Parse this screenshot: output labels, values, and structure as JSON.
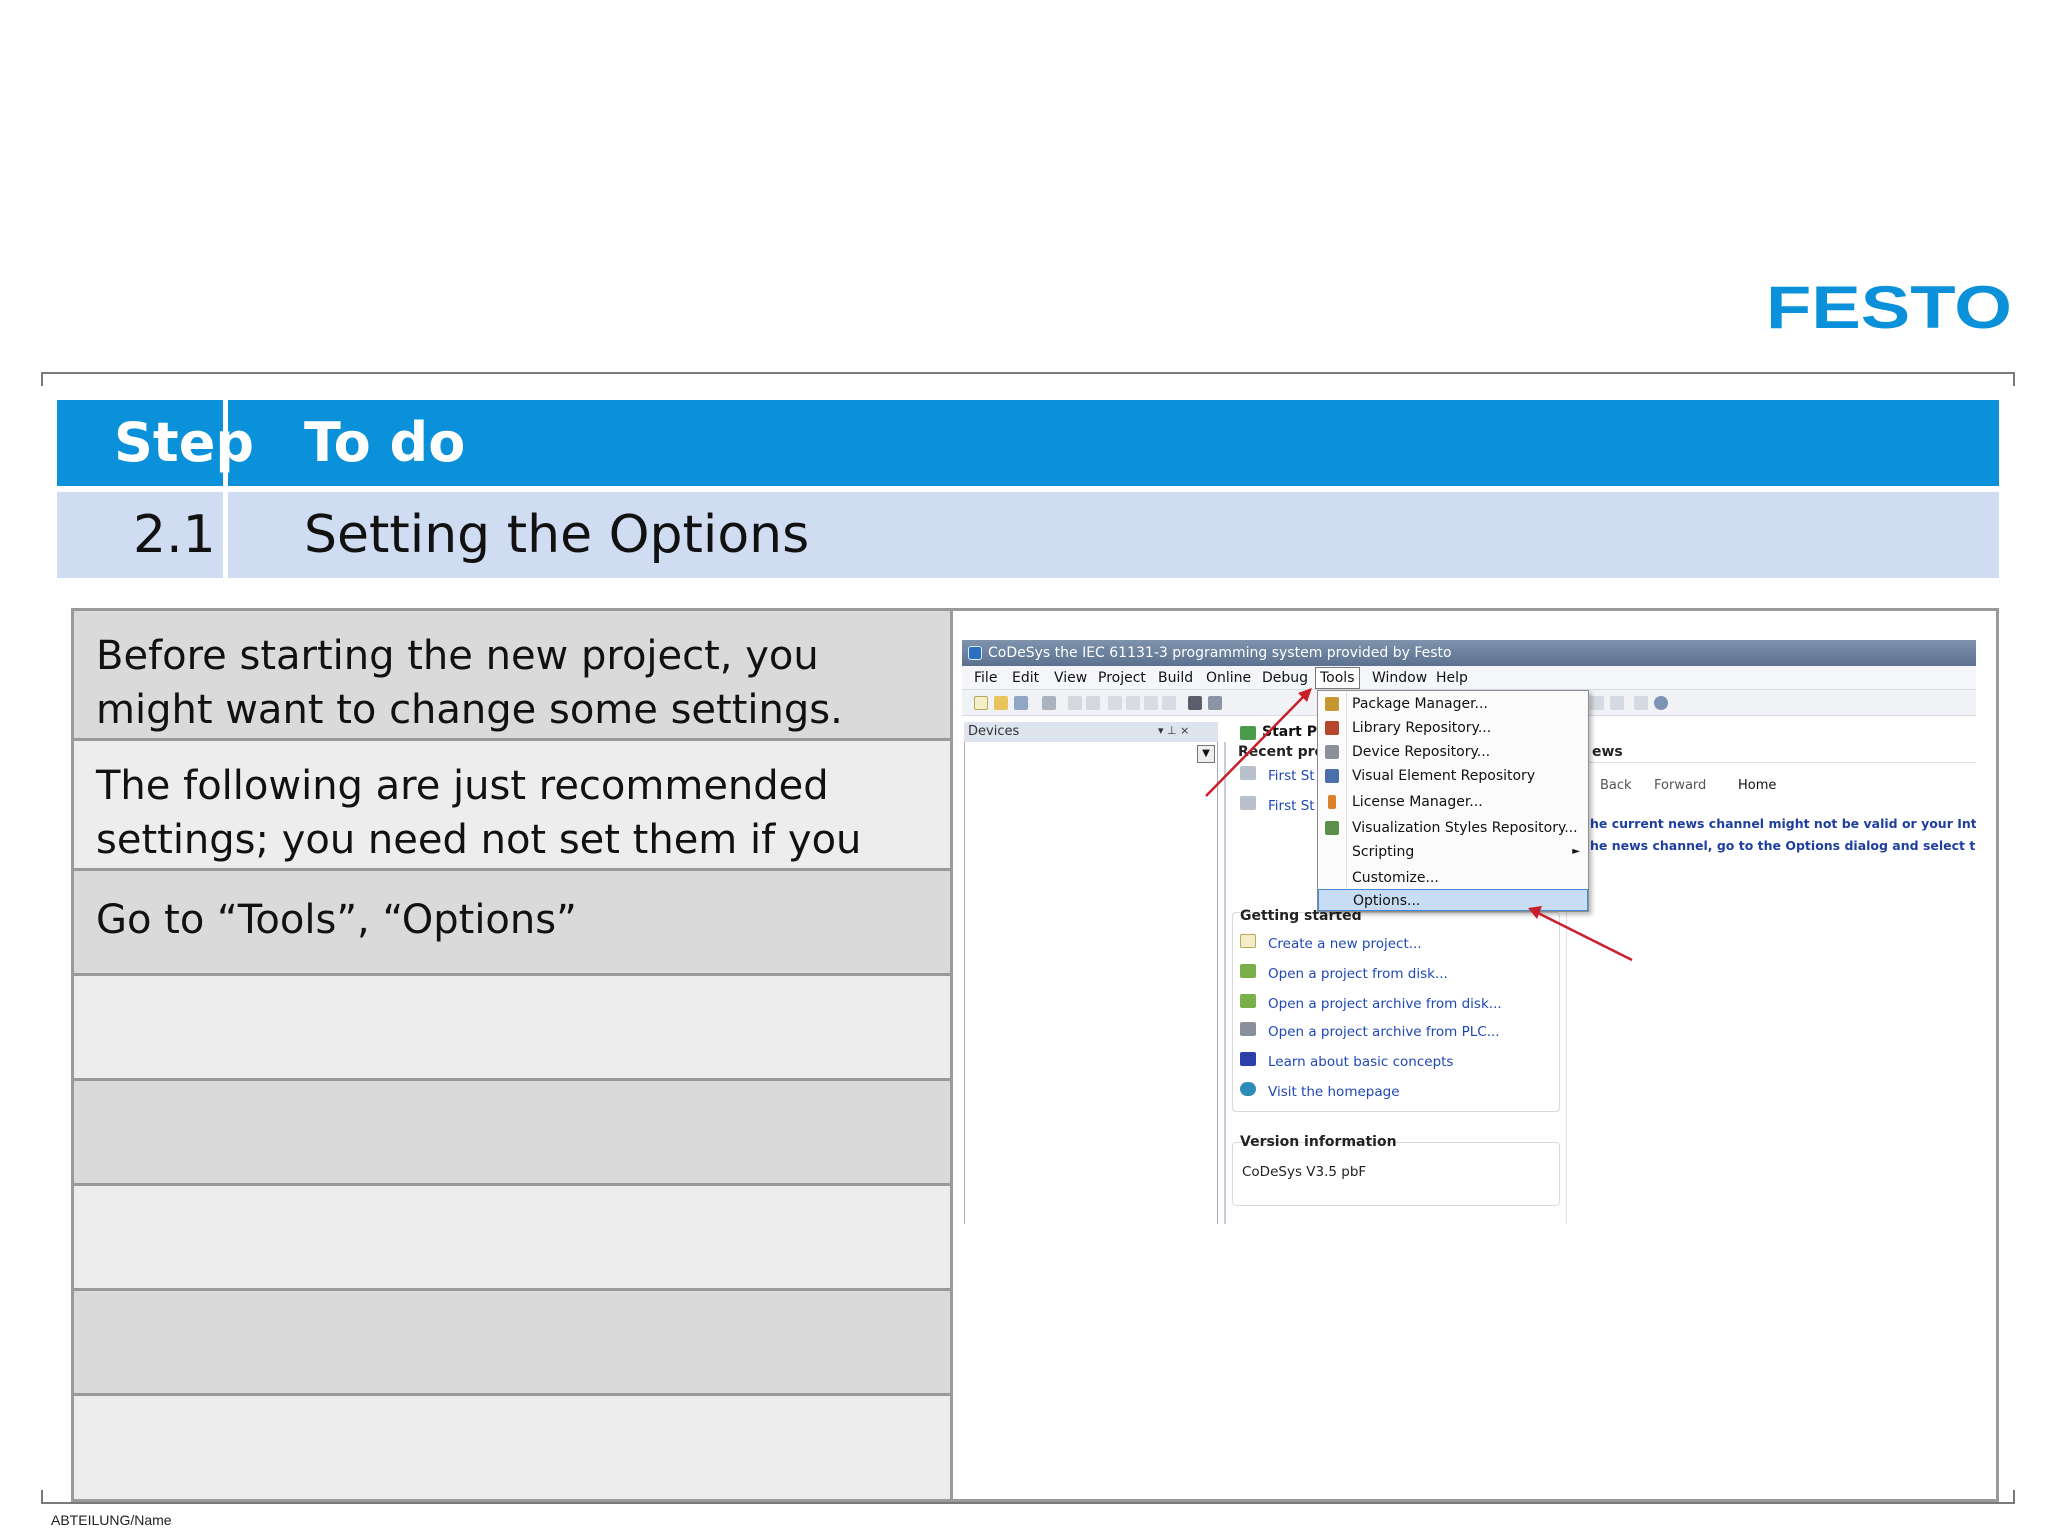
{
  "brand": {
    "logo_text": "FESTO",
    "color": "#0a91da"
  },
  "step_table": {
    "header": {
      "step": "Step",
      "todo": "To do"
    },
    "row": {
      "step": "2.1",
      "todo": "Setting the Options"
    }
  },
  "todo_rows": [
    "Before starting the new project, you might want to change some settings.",
    "The following are just recommended settings; you need not set them if you wish.",
    "Go to “Tools”, “Options”",
    "",
    "",
    "",
    "",
    ""
  ],
  "screenshot": {
    "window_title": "CoDeSys the IEC 61131-3 programming system provided by Festo",
    "menu": [
      "File",
      "Edit",
      "View",
      "Project",
      "Build",
      "Online",
      "Debug",
      "Tools",
      "Window",
      "Help"
    ],
    "devices_title": "Devices",
    "devices_tools": "▾ ⊥ ×",
    "start_tab": "Start P",
    "recent_projects": "Recent pro",
    "recent_items": [
      "First St",
      "First St"
    ],
    "news_title": "ews",
    "news_nav": {
      "back": "Back",
      "forward": "Forward",
      "home": "Home"
    },
    "news_lines": [
      "he current news channel might not be valid or your Interr",
      "he news channel, go to the Options dialog and select the I"
    ],
    "getting_started_title": "Getting started",
    "getting_started_links": [
      "Create a new project...",
      "Open a project from disk...",
      "Open a project archive from disk...",
      "Open a project archive from PLC...",
      "Learn about basic concepts",
      "Visit the homepage"
    ],
    "version_title": "Version information",
    "version_value": "CoDeSys V3.5 pbF",
    "tools_menu": [
      "Package Manager...",
      "Library Repository...",
      "Device Repository...",
      "Visual Element Repository",
      "License Manager...",
      "Visualization Styles Repository...",
      "Scripting",
      "Customize...",
      "Options..."
    ],
    "highlight_color": "#c8dcf4",
    "arrow_color": "#c8202a"
  },
  "footer": "ABTEILUNG/Name"
}
